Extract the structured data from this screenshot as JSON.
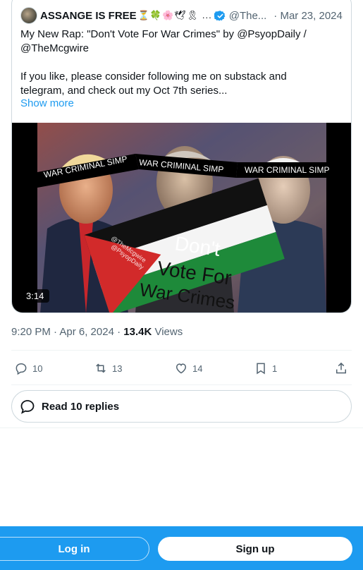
{
  "quoted_post": {
    "author_name": "ASSANGE IS FREE",
    "author_emoji": "⏳🍀🌸🕊🎗 ...",
    "handle": "@The...",
    "date": "· Mar 23, 2024",
    "text_line1": "My New Rap: \"Don't Vote For War Crimes\" by @PsyopDaily / @TheMcgwire",
    "text_line2": "If you like, please consider following me on substack and telegram, and check out my Oct 7th series...",
    "show_more": "Show more",
    "video_duration": "3:14",
    "media_text": {
      "banner_left": "WAR CRIMINAL SIMP",
      "banner_center": "WAR CRIMINAL SIMP",
      "banner_right": "WAR CRIMINAL SIMP",
      "title_1": "Don't",
      "title_2": "Vote For",
      "title_3": "War Crimes",
      "watermark_1": "@TheMcgwire",
      "watermark_2": "@PsyopDaily"
    }
  },
  "post_meta": {
    "time": "9:20 PM · Apr 6, 2024 · ",
    "views_count": "13.4K",
    "views_label": " Views"
  },
  "actions": {
    "replies": "10",
    "reposts": "13",
    "likes": "14",
    "bookmarks": "1"
  },
  "read_replies": "Read 10 replies",
  "auth": {
    "login": "Log in",
    "signup": "Sign up"
  },
  "colors": {
    "accent": "#1d9bf0",
    "text_primary": "#0f1419",
    "text_secondary": "#536471",
    "border": "#cfd9de"
  }
}
